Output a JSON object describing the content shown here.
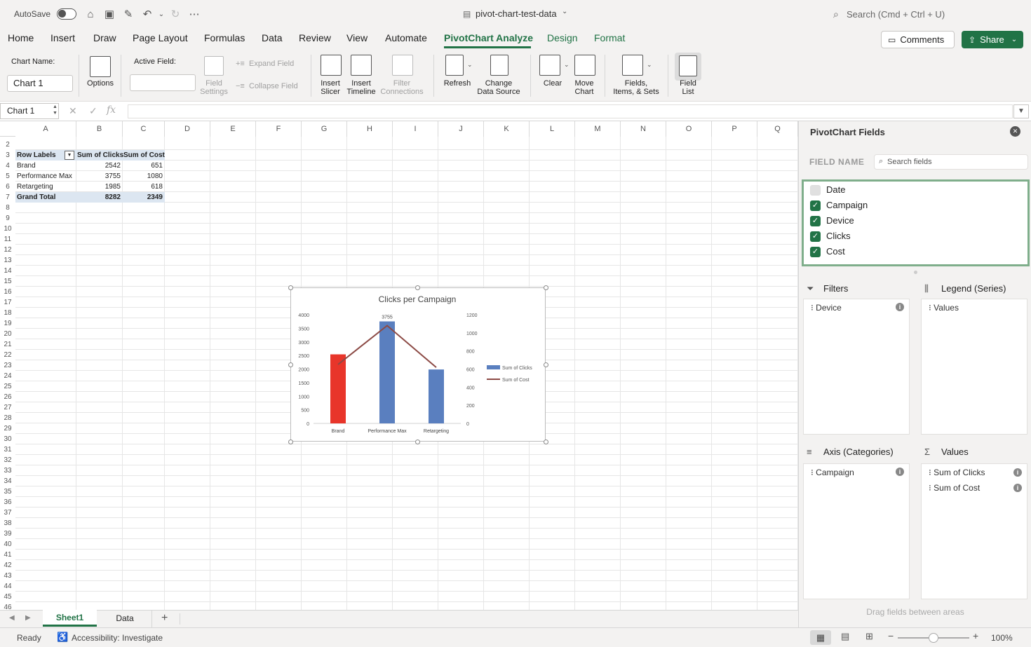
{
  "titlebar": {
    "autosave_label": "AutoSave",
    "file_name": "pivot-chart-test-data",
    "search_placeholder": "Search (Cmd + Ctrl + U)"
  },
  "menu": {
    "tabs": [
      "Home",
      "Insert",
      "Draw",
      "Page Layout",
      "Formulas",
      "Data",
      "Review",
      "View",
      "Automate",
      "PivotChart Analyze",
      "Design",
      "Format"
    ],
    "active": "PivotChart Analyze",
    "comments_label": "Comments",
    "share_label": "Share"
  },
  "ribbon": {
    "chart_name_label": "Chart Name:",
    "chart_name_value": "Chart 1",
    "options_label": "Options",
    "active_field_label": "Active Field:",
    "field_settings_line1": "Field",
    "field_settings_line2": "Settings",
    "expand_field": "Expand Field",
    "collapse_field": "Collapse Field",
    "insert_slicer_line1": "Insert",
    "insert_slicer_line2": "Slicer",
    "insert_timeline_line1": "Insert",
    "insert_timeline_line2": "Timeline",
    "filter_connections_line1": "Filter",
    "filter_connections_line2": "Connections",
    "refresh_label": "Refresh",
    "change_data_source_line1": "Change",
    "change_data_source_line2": "Data Source",
    "clear_label": "Clear",
    "move_chart_line1": "Move",
    "move_chart_line2": "Chart",
    "fields_items_line1": "Fields,",
    "fields_items_line2": "Items, & Sets",
    "field_list_line1": "Field",
    "field_list_line2": "List"
  },
  "formula_bar": {
    "name_box": "Chart 1",
    "fx": "fx"
  },
  "sheet": {
    "columns": [
      "A",
      "B",
      "C",
      "D",
      "E",
      "F",
      "G",
      "H",
      "I",
      "J",
      "K",
      "L",
      "M",
      "N",
      "O",
      "P",
      "Q"
    ],
    "rows": [
      "2",
      "3",
      "4",
      "5",
      "6",
      "7",
      "8",
      "9",
      "10",
      "11",
      "12",
      "13",
      "14",
      "15",
      "16",
      "17",
      "18",
      "19",
      "20",
      "21",
      "22",
      "23",
      "24",
      "25",
      "26",
      "27",
      "28",
      "29",
      "30",
      "31",
      "32",
      "33",
      "34",
      "35",
      "36",
      "37",
      "38",
      "39",
      "40",
      "41",
      "42",
      "43",
      "44",
      "45",
      "46"
    ],
    "pivot": {
      "headers": [
        "Row Labels",
        "Sum of Clicks",
        "Sum of Cost"
      ],
      "rows": [
        {
          "label": "Brand",
          "clicks": "2542",
          "cost": "651"
        },
        {
          "label": "Performance Max",
          "clicks": "3755",
          "cost": "1080"
        },
        {
          "label": "Retargeting",
          "clicks": "1985",
          "cost": "618"
        }
      ],
      "total": {
        "label": "Grand Total",
        "clicks": "8282",
        "cost": "2349"
      }
    }
  },
  "chart_data": {
    "type": "bar",
    "title": "Clicks per Campaign",
    "categories": [
      "Brand",
      "Performance Max",
      "Retargeting"
    ],
    "series": [
      {
        "name": "Sum of Clicks",
        "type": "bar",
        "axis": "left",
        "values": [
          2542,
          3755,
          1985
        ],
        "colors": [
          "#e8352a",
          "#5a7fbf",
          "#5a7fbf"
        ]
      },
      {
        "name": "Sum of Cost",
        "type": "line",
        "axis": "right",
        "values": [
          651,
          1080,
          618
        ],
        "color": "#8c4a45"
      }
    ],
    "data_labels": [
      {
        "category": "Performance Max",
        "text": "3755"
      }
    ],
    "ylim": [
      0,
      4000
    ],
    "yticks": [
      "0",
      "500",
      "1000",
      "1500",
      "2000",
      "2500",
      "3000",
      "3500",
      "4000"
    ],
    "y2lim": [
      0,
      1200
    ],
    "y2ticks": [
      "0",
      "200",
      "400",
      "600",
      "800",
      "1000",
      "1200"
    ],
    "legend_position": "right"
  },
  "panel": {
    "title": "PivotChart Fields",
    "field_name_label": "FIELD NAME",
    "search_placeholder": "Search fields",
    "fields": [
      {
        "name": "Date",
        "checked": false
      },
      {
        "name": "Campaign",
        "checked": true
      },
      {
        "name": "Device",
        "checked": true
      },
      {
        "name": "Clicks",
        "checked": true
      },
      {
        "name": "Cost",
        "checked": true
      }
    ],
    "filters_title": "Filters",
    "filters_items": [
      "Device"
    ],
    "legend_title": "Legend (Series)",
    "legend_items": [
      "Values"
    ],
    "axis_title": "Axis (Categories)",
    "axis_items": [
      "Campaign"
    ],
    "values_title": "Values",
    "values_items": [
      "Sum of Clicks",
      "Sum of Cost"
    ],
    "drag_hint": "Drag fields between areas"
  },
  "sheet_tabs": [
    "Sheet1",
    "Data"
  ],
  "active_sheet": "Sheet1",
  "status": {
    "ready": "Ready",
    "accessibility": "Accessibility: Investigate",
    "zoom": "100%"
  },
  "colors": {
    "accent": "#217346",
    "ribbon_bg": "#f3f2f1"
  }
}
